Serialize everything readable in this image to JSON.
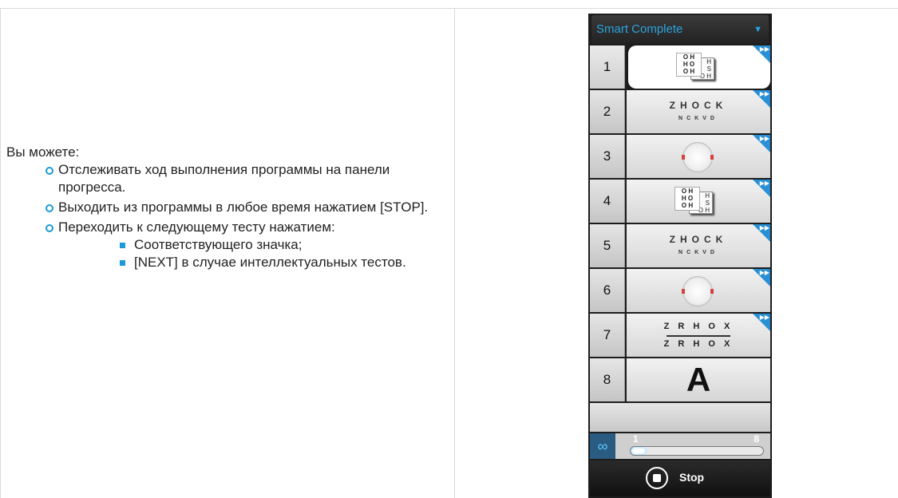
{
  "text": {
    "intro": "Вы можете:",
    "items": [
      "Отслеживать ход выполнения программы на панели прогресса.",
      "Выходить из программы в любое время нажатием [STOP].",
      "Переходить к следующему тесту нажатием:"
    ],
    "subitems": [
      "Соответствующего значка;",
      "[NEXT] в случае интеллектуальных тестов."
    ]
  },
  "panel": {
    "title": "Smart Complete",
    "rows": [
      {
        "num": "1",
        "content": "chart",
        "lines": [
          "O H",
          "H O",
          "O H"
        ],
        "back": [
          "H",
          "S",
          "O H"
        ]
      },
      {
        "num": "2",
        "content": "letters",
        "big": "ZHOCK",
        "small": "NCKVD"
      },
      {
        "num": "3",
        "content": "dots"
      },
      {
        "num": "4",
        "content": "chart",
        "lines": [
          "O H",
          "H O",
          "O H"
        ],
        "back": [
          "H",
          "S",
          "O H"
        ]
      },
      {
        "num": "5",
        "content": "letters",
        "big": "ZHOCK",
        "small": "NCKVD"
      },
      {
        "num": "6",
        "content": "dots"
      },
      {
        "num": "7",
        "content": "zr",
        "top": "Z R H O X",
        "bottom": "Z R H O X"
      },
      {
        "num": "8",
        "content": "A",
        "big": "A"
      }
    ],
    "progress": {
      "start": "1",
      "end": "8",
      "fraction": 0.12
    },
    "stop_label": "Stop",
    "accent": "#2ba3e0"
  }
}
